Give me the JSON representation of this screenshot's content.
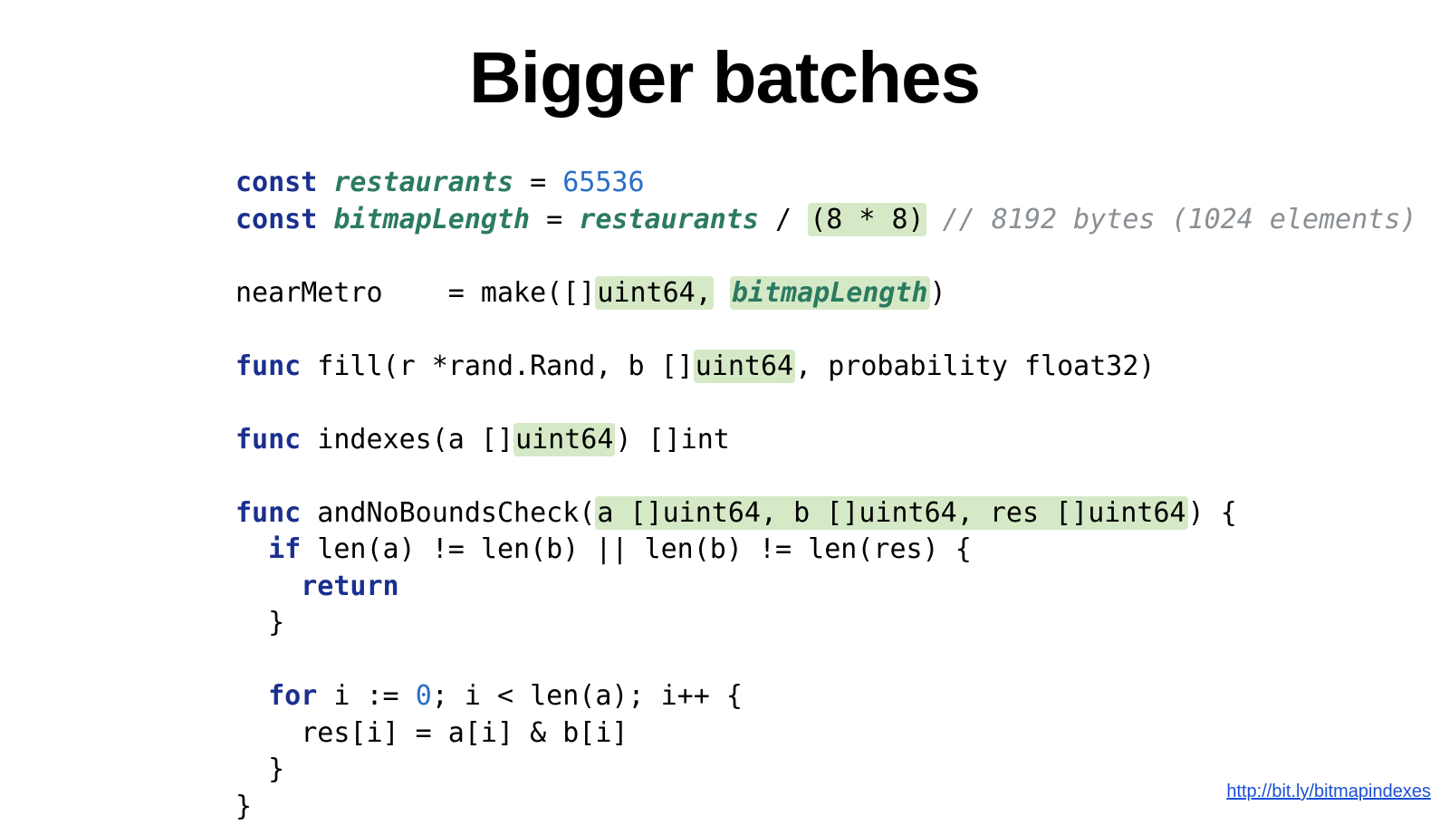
{
  "title": "Bigger batches",
  "code": {
    "l1": {
      "kw1": "const",
      "id1": "restaurants",
      "eq": " = ",
      "num1": "65536"
    },
    "l2": {
      "kw1": "const",
      "id1": "bitmapLength",
      "eq": " = ",
      "id2": "restaurants",
      "div": " / ",
      "hl1": "(8 * 8)",
      "cmt": " // 8192 bytes (1024 elements)"
    },
    "l3": {
      "lhs": "nearMetro    = make([]",
      "hl1": "uint64,",
      "sp": " ",
      "hlId": "bitmapLength",
      "tail": ")"
    },
    "l4": {
      "kw1": "func",
      "sig1": " fill(r *rand.Rand, b []",
      "hl1": "uint64",
      "sig2": ", probability float32)"
    },
    "l5": {
      "kw1": "func",
      "sig1": " indexes(a []",
      "hl1": "uint64",
      "sig2": ") []int"
    },
    "l6": {
      "kw1": "func",
      "sig1": " andNoBoundsCheck(",
      "hl1": "a []uint64, b []uint64, res []uint64",
      "sig2": ") {"
    },
    "l7": {
      "kw1": "if",
      "body": " len(a) != len(b) || len(b) != len(res) {"
    },
    "l8": {
      "kw1": "return"
    },
    "l9": {
      "body": "  }"
    },
    "l10": {
      "kw1": "for",
      "pre": " i := ",
      "num1": "0",
      "post": "; i < len(a); i++ {"
    },
    "l11": {
      "body": "    res[i] = a[i] & b[i]"
    },
    "l12": {
      "body": "  }"
    },
    "l13": {
      "body": "}"
    }
  },
  "footer_link": "http://bit.ly/bitmapindexes"
}
